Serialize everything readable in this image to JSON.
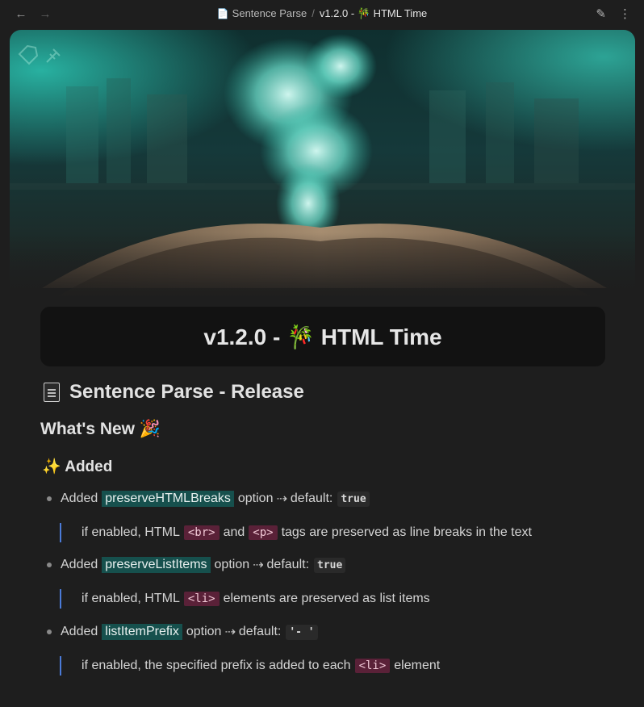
{
  "topbar": {
    "back_icon": "arrow-left-icon",
    "forward_icon": "arrow-right-icon",
    "breadcrumb_parent": "Sentence Parse",
    "breadcrumb_separator": "/",
    "breadcrumb_current": "v1.2.0 - 🎋 HTML Time",
    "edit_icon": "pencil-icon",
    "more_icon": "more-vertical-icon"
  },
  "banner": {
    "icons": [
      "tag-icon",
      "pin-icon"
    ]
  },
  "title_card": {
    "title": "v1.2.0 - 🎋 HTML Time"
  },
  "headings": {
    "page_title": "Sentence Parse - Release",
    "whats_new": "What's New 🎉",
    "added": "✨ Added"
  },
  "items": [
    {
      "prefix": "Added",
      "option": "preserveHTMLBreaks",
      "middle": "option",
      "arrow": "⇢",
      "default_label": "default:",
      "default_value": "true",
      "desc_before": "if enabled, HTML",
      "tag1": "<br>",
      "desc_mid": "and",
      "tag2": "<p>",
      "desc_after": "tags are preserved as line breaks in the text"
    },
    {
      "prefix": "Added",
      "option": "preserveListItems",
      "middle": "option",
      "arrow": "⇢",
      "default_label": "default:",
      "default_value": "true",
      "desc_before": "if enabled, HTML",
      "tag1": "<li>",
      "desc_after": "elements are preserved as list items"
    },
    {
      "prefix": "Added",
      "option": "listItemPrefix",
      "middle": "option",
      "arrow": "⇢",
      "default_label": "default:",
      "default_value": "'- '",
      "desc_before": "if enabled, the specified prefix is added to each",
      "tag1": "<li>",
      "desc_after": "element"
    }
  ],
  "colors": {
    "background": "#1e1e1e",
    "title_card": "#121212",
    "option_highlight": "#16504d",
    "tag_highlight": "#5a2138",
    "quote_border": "#4b7bd8"
  }
}
